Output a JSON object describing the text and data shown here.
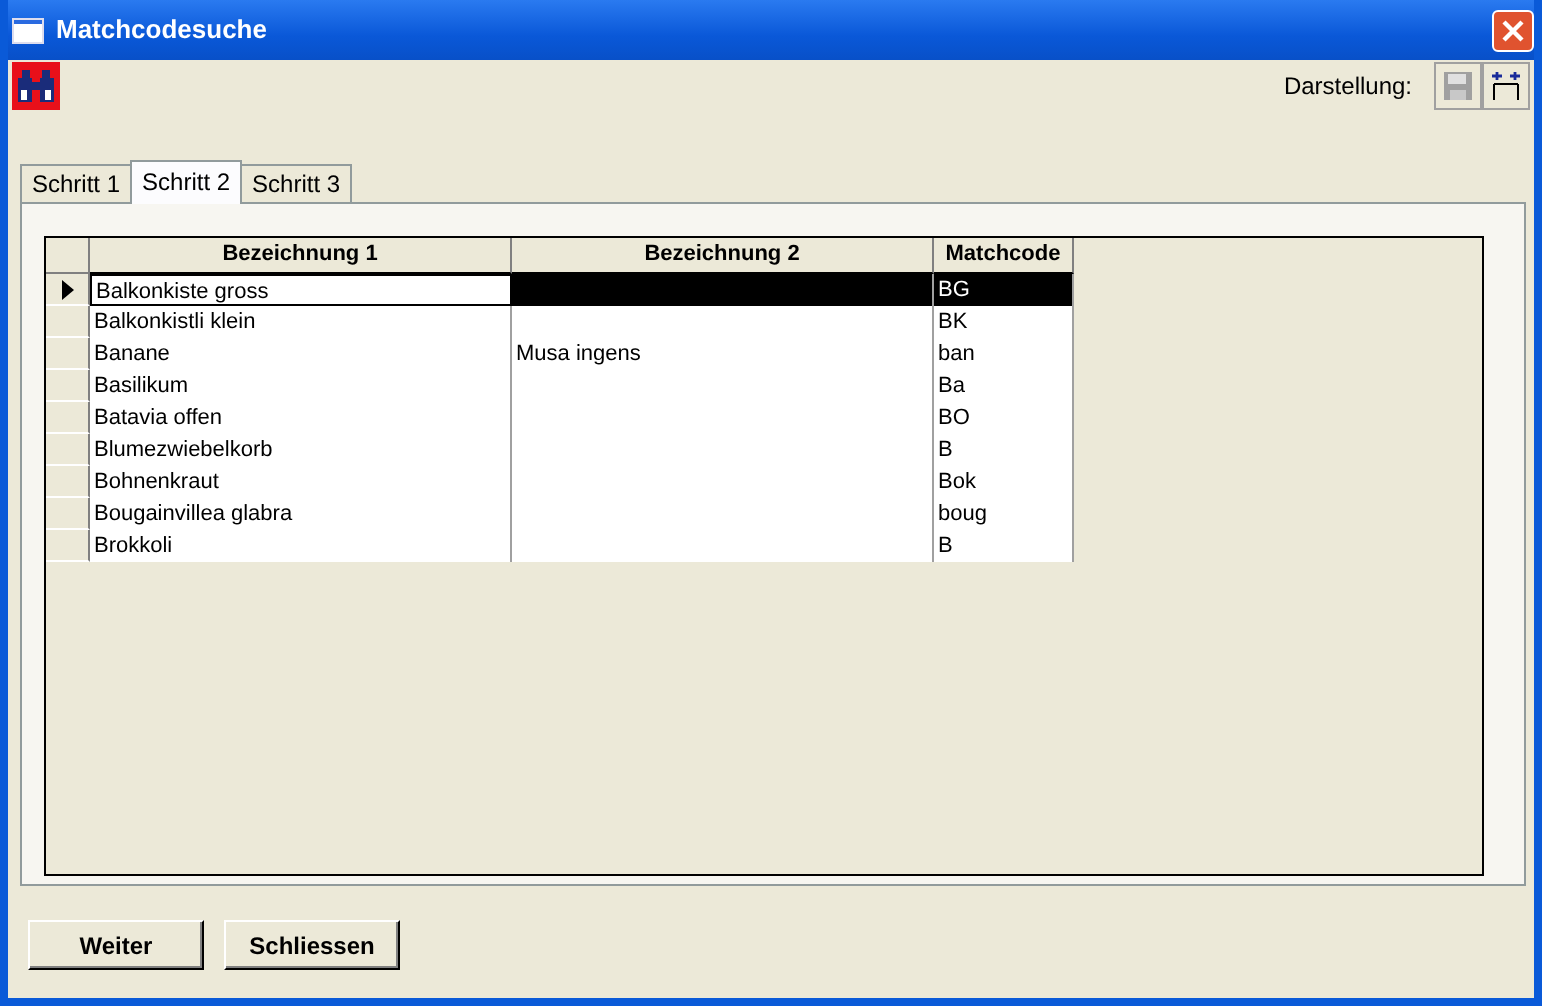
{
  "window": {
    "title": "Matchcodesuche"
  },
  "toolbar": {
    "label": "Darstellung:"
  },
  "tabs": [
    {
      "label": "Schritt 1",
      "selected": false
    },
    {
      "label": "Schritt 2",
      "selected": true
    },
    {
      "label": "Schritt 3",
      "selected": false
    }
  ],
  "table": {
    "columns": [
      "Bezeichnung 1",
      "Bezeichnung 2",
      "Matchcode"
    ],
    "rows": [
      {
        "cells": [
          "Balkonkiste gross",
          "",
          "BG"
        ],
        "selected": true
      },
      {
        "cells": [
          "Balkonkistli klein",
          "",
          "BK"
        ],
        "selected": false
      },
      {
        "cells": [
          "Banane",
          "Musa ingens",
          "ban"
        ],
        "selected": false
      },
      {
        "cells": [
          "Basilikum",
          "",
          "Ba"
        ],
        "selected": false
      },
      {
        "cells": [
          "Batavia offen",
          "",
          "BO"
        ],
        "selected": false
      },
      {
        "cells": [
          "Blumezwiebelkorb",
          "",
          "B"
        ],
        "selected": false
      },
      {
        "cells": [
          "Bohnenkraut",
          "",
          "Bok"
        ],
        "selected": false
      },
      {
        "cells": [
          "Bougainvillea glabra",
          "",
          "boug"
        ],
        "selected": false
      },
      {
        "cells": [
          "Brokkoli",
          "",
          "B"
        ],
        "selected": false
      }
    ]
  },
  "buttons": [
    "Weiter",
    "Schliessen"
  ]
}
